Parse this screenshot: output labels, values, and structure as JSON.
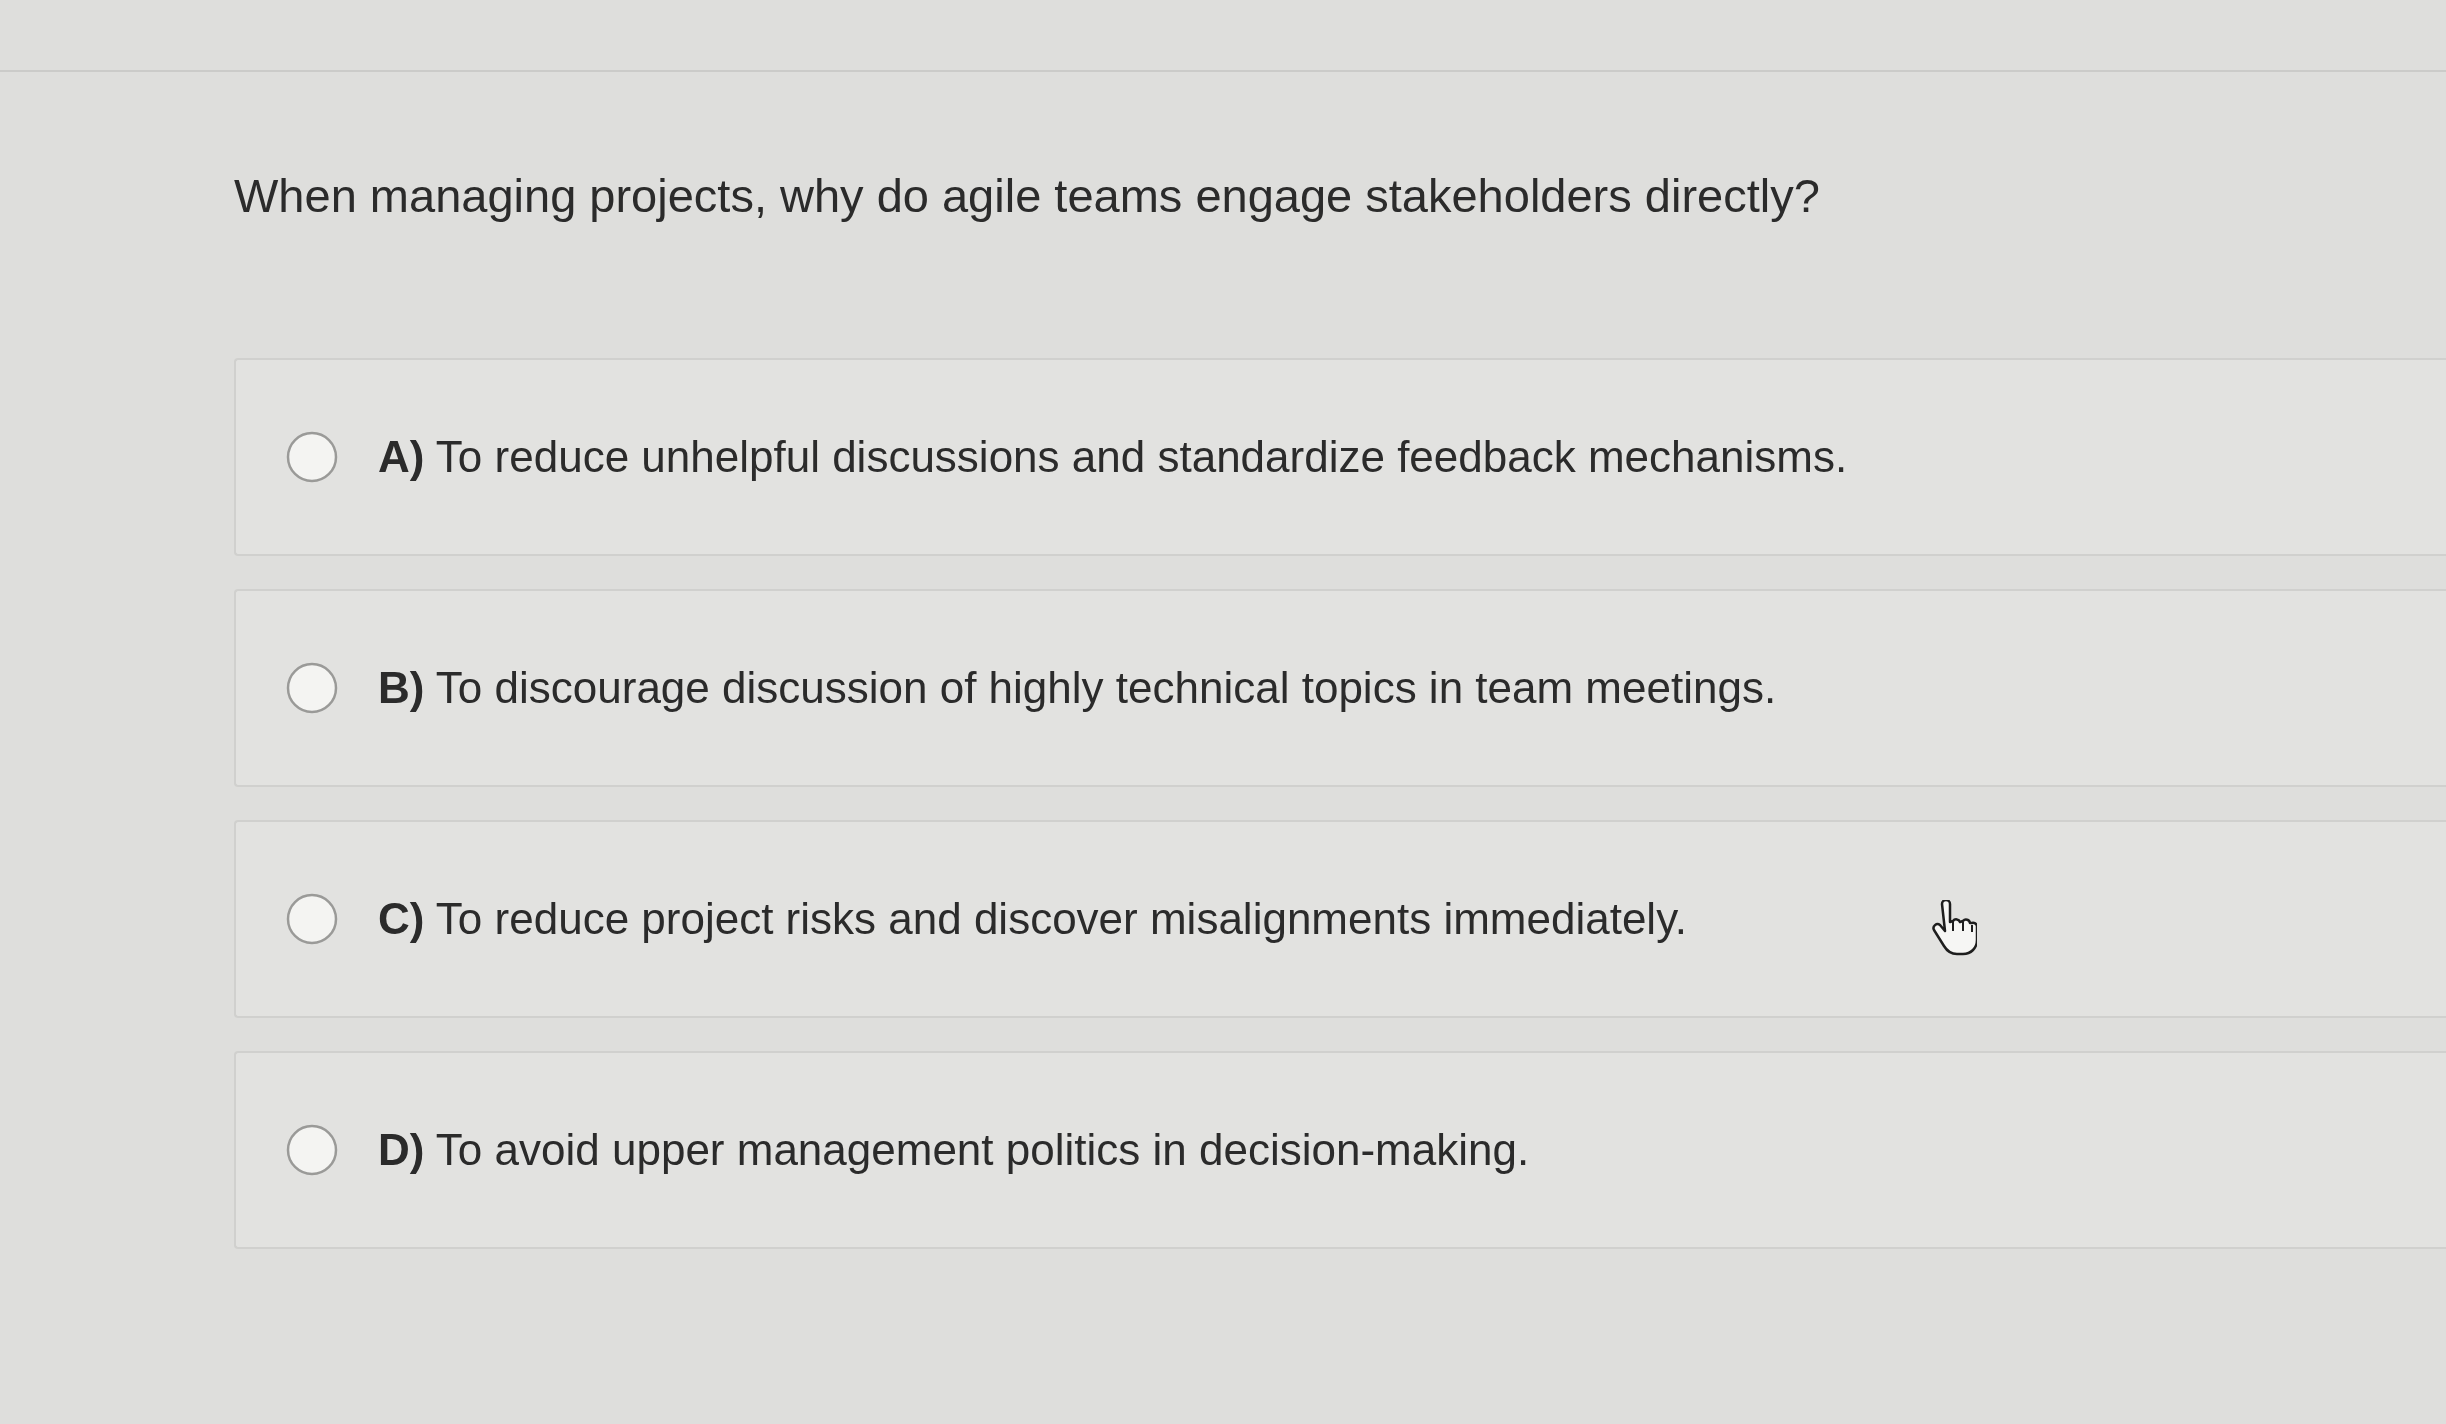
{
  "question": "When managing projects, why do agile teams engage stakeholders directly?",
  "options": [
    {
      "label": "**A)** To reduce unhelpful discussions and standardize feedback mechanisms.",
      "selected": false
    },
    {
      "label": "**B)** To discourage discussion of highly technical topics in team meetings.",
      "selected": false
    },
    {
      "label": "**C)** To reduce project risks and discover misalignments immediately.",
      "selected": false
    },
    {
      "label": "**D)** To avoid upper management politics in decision-making.",
      "selected": false
    }
  ]
}
